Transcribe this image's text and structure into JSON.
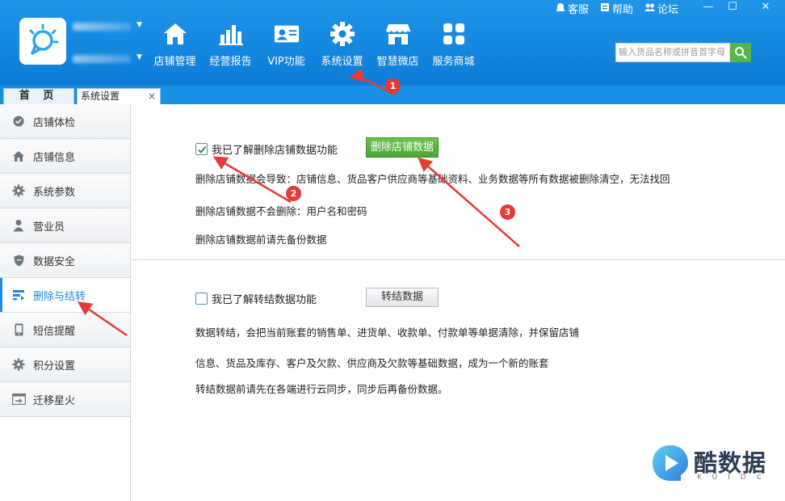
{
  "header": {
    "nav": [
      {
        "label": "店铺管理",
        "icon": "store-home-icon"
      },
      {
        "label": "经营报告",
        "icon": "bar-chart-icon"
      },
      {
        "label": "VIP功能",
        "icon": "vip-card-icon"
      },
      {
        "label": "系统设置",
        "icon": "gear-icon"
      },
      {
        "label": "智慧微店",
        "icon": "shop-awning-icon"
      },
      {
        "label": "服务商城",
        "icon": "grid-apps-icon"
      }
    ],
    "top_links": [
      {
        "label": "客服",
        "icon": "customer-service-icon"
      },
      {
        "label": "帮助",
        "icon": "help-icon"
      },
      {
        "label": "论坛",
        "icon": "forum-icon"
      }
    ],
    "window_controls": {
      "minimize": "—",
      "maximize": "☐",
      "close": "✕"
    },
    "search": {
      "placeholder": "输入货品名称或拼音首字母"
    },
    "colors": {
      "header": "#1386de",
      "accent_green": "#4aa536",
      "annotation_red": "#e53a35"
    }
  },
  "tabs": {
    "home": "首 页",
    "current": "系统设置",
    "close": "×"
  },
  "sidebar": {
    "items": [
      {
        "label": "店铺体检",
        "icon": "check-circle-icon",
        "active": false
      },
      {
        "label": "店铺信息",
        "icon": "house-icon",
        "active": false
      },
      {
        "label": "系统参数",
        "icon": "gear-icon",
        "active": false
      },
      {
        "label": "营业员",
        "icon": "person-icon",
        "active": false
      },
      {
        "label": "数据安全",
        "icon": "shield-icon",
        "active": false
      },
      {
        "label": "删除与结转",
        "icon": "delete-transfer-icon",
        "active": true
      },
      {
        "label": "短信提醒",
        "icon": "phone-icon",
        "active": false
      },
      {
        "label": "积分设置",
        "icon": "gear-icon",
        "active": false
      },
      {
        "label": "迁移星火",
        "icon": "migrate-icon",
        "active": false
      }
    ]
  },
  "delete_section": {
    "checkbox_label": "我已了解删除店铺数据功能",
    "checked": true,
    "button_label": "删除店铺数据",
    "line1": "删除店铺数据会导致：店铺信息、货品客户供应商等基础资料、业务数据等所有数据被删除清空，无法找回",
    "line2": "删除店铺数据不会删除：用户名和密码",
    "line3": "删除店铺数据前请先备份数据"
  },
  "transfer_section": {
    "checkbox_label": "我已了解转结数据功能",
    "checked": false,
    "button_label": "转结数据",
    "line1": "数据转结，会把当前账套的销售单、进货单、收款单、付款单等单据清除，并保留店铺",
    "line2": "信息、货品及库存、客户及欠款、供应商及欠款等基础数据，成为一个新的账套",
    "line3": "转结数据前请先在各端进行云同步，同步后再备份数据。"
  },
  "annotations": [
    {
      "number": "1"
    },
    {
      "number": "2"
    },
    {
      "number": "3"
    }
  ],
  "watermark": {
    "text": "酷数据",
    "sub": "KUIDC"
  }
}
